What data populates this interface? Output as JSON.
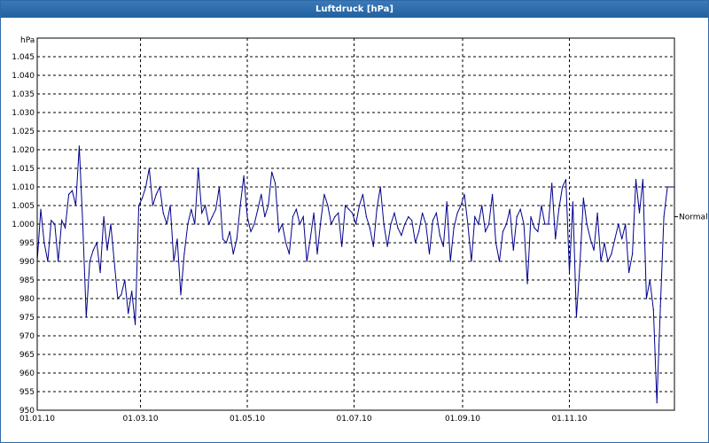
{
  "window": {
    "title": "Luftdruck [hPa]"
  },
  "chart_data": {
    "type": "line",
    "title": "Luftdruck [hPa]",
    "ylabel": "hPa",
    "ylim": [
      950,
      1050
    ],
    "yticks": [
      950,
      955,
      960,
      965,
      970,
      975,
      980,
      985,
      990,
      995,
      1000,
      1005,
      1010,
      1015,
      1020,
      1025,
      1030,
      1035,
      1040,
      1045
    ],
    "ytick_labels": [
      "950",
      "955",
      "960",
      "965",
      "970",
      "975",
      "980",
      "985",
      "990",
      "995",
      "1.000",
      "1.005",
      "1.010",
      "1.015",
      "1.020",
      "1.025",
      "1.030",
      "1.035",
      "1.040",
      "1.045"
    ],
    "xlim": [
      "2010-01-01",
      "2010-12-31"
    ],
    "xticks": [
      "2010-01-01",
      "2010-03-01",
      "2010-05-01",
      "2010-07-01",
      "2010-09-01",
      "2010-11-01"
    ],
    "xtick_labels": [
      "01.01.10",
      "01.03.10",
      "01.05.10",
      "01.07.10",
      "01.09.10",
      "01.11.10"
    ],
    "grid": true,
    "reference_line": {
      "label": "Normal",
      "value": 1002
    },
    "series_color": "#00008b",
    "series": [
      {
        "x": [
          "2010-01-01",
          "2010-01-03",
          "2010-01-05",
          "2010-01-07",
          "2010-01-09",
          "2010-01-11",
          "2010-01-13",
          "2010-01-15",
          "2010-01-17",
          "2010-01-19",
          "2010-01-21",
          "2010-01-23",
          "2010-01-25",
          "2010-01-27",
          "2010-01-29",
          "2010-01-31",
          "2010-02-02",
          "2010-02-04",
          "2010-02-06",
          "2010-02-08",
          "2010-02-10",
          "2010-02-12",
          "2010-02-14",
          "2010-02-16",
          "2010-02-18",
          "2010-02-20",
          "2010-02-22",
          "2010-02-24",
          "2010-02-26",
          "2010-02-28",
          "2010-03-02",
          "2010-03-04",
          "2010-03-06",
          "2010-03-08",
          "2010-03-10",
          "2010-03-12",
          "2010-03-14",
          "2010-03-16",
          "2010-03-18",
          "2010-03-20",
          "2010-03-22",
          "2010-03-24",
          "2010-03-26",
          "2010-03-28",
          "2010-03-30",
          "2010-04-01",
          "2010-04-03",
          "2010-04-05",
          "2010-04-07",
          "2010-04-09",
          "2010-04-11",
          "2010-04-13",
          "2010-04-15",
          "2010-04-17",
          "2010-04-19",
          "2010-04-21",
          "2010-04-23",
          "2010-04-25",
          "2010-04-27",
          "2010-04-29",
          "2010-05-01",
          "2010-05-03",
          "2010-05-05",
          "2010-05-07",
          "2010-05-09",
          "2010-05-11",
          "2010-05-13",
          "2010-05-15",
          "2010-05-17",
          "2010-05-19",
          "2010-05-21",
          "2010-05-23",
          "2010-05-25",
          "2010-05-27",
          "2010-05-29",
          "2010-05-31",
          "2010-06-02",
          "2010-06-04",
          "2010-06-06",
          "2010-06-08",
          "2010-06-10",
          "2010-06-12",
          "2010-06-14",
          "2010-06-16",
          "2010-06-18",
          "2010-06-20",
          "2010-06-22",
          "2010-06-24",
          "2010-06-26",
          "2010-06-28",
          "2010-06-30",
          "2010-07-02",
          "2010-07-04",
          "2010-07-06",
          "2010-07-08",
          "2010-07-10",
          "2010-07-12",
          "2010-07-14",
          "2010-07-16",
          "2010-07-18",
          "2010-07-20",
          "2010-07-22",
          "2010-07-24",
          "2010-07-26",
          "2010-07-28",
          "2010-07-30",
          "2010-08-01",
          "2010-08-03",
          "2010-08-05",
          "2010-08-07",
          "2010-08-09",
          "2010-08-11",
          "2010-08-13",
          "2010-08-15",
          "2010-08-17",
          "2010-08-19",
          "2010-08-21",
          "2010-08-23",
          "2010-08-25",
          "2010-08-27",
          "2010-08-29",
          "2010-08-31",
          "2010-09-02",
          "2010-09-04",
          "2010-09-06",
          "2010-09-08",
          "2010-09-10",
          "2010-09-12",
          "2010-09-14",
          "2010-09-16",
          "2010-09-18",
          "2010-09-20",
          "2010-09-22",
          "2010-09-24",
          "2010-09-26",
          "2010-09-28",
          "2010-09-30",
          "2010-10-02",
          "2010-10-04",
          "2010-10-06",
          "2010-10-08",
          "2010-10-10",
          "2010-10-12",
          "2010-10-14",
          "2010-10-16",
          "2010-10-18",
          "2010-10-20",
          "2010-10-22",
          "2010-10-24",
          "2010-10-26",
          "2010-10-28",
          "2010-10-30",
          "2010-11-01",
          "2010-11-03",
          "2010-11-05",
          "2010-11-07",
          "2010-11-09",
          "2010-11-11",
          "2010-11-13",
          "2010-11-15",
          "2010-11-17",
          "2010-11-19",
          "2010-11-21",
          "2010-11-23",
          "2010-11-25",
          "2010-11-27",
          "2010-11-29",
          "2010-12-01",
          "2010-12-03",
          "2010-12-05",
          "2010-12-07",
          "2010-12-09",
          "2010-12-11",
          "2010-12-13",
          "2010-12-15",
          "2010-12-17",
          "2010-12-19",
          "2010-12-21",
          "2010-12-23",
          "2010-12-25",
          "2010-12-27",
          "2010-12-29",
          "2010-12-31"
        ],
        "values": [
          990,
          1004,
          995,
          990,
          1001,
          1000,
          990,
          1001,
          999,
          1008,
          1009,
          1005,
          1021,
          1000,
          975,
          990,
          993,
          995,
          987,
          1002,
          993,
          1000,
          990,
          980,
          981,
          985,
          976,
          982,
          973,
          1005,
          1007,
          1010,
          1015,
          1005,
          1008,
          1010,
          1003,
          1000,
          1005,
          990,
          996,
          981,
          992,
          1000,
          1004,
          1000,
          1015,
          1003,
          1005,
          1000,
          1002,
          1004,
          1010,
          996,
          995,
          998,
          992,
          996,
          1005,
          1013,
          1002,
          998,
          1000,
          1004,
          1008,
          1002,
          1005,
          1014,
          1011,
          998,
          1000,
          995,
          992,
          1002,
          1004,
          1000,
          1002,
          990,
          996,
          1003,
          992,
          1001,
          1008,
          1005,
          1000,
          1002,
          1003,
          994,
          1005,
          1004,
          1003,
          1000,
          1005,
          1008,
          1002,
          999,
          994,
          1004,
          1010,
          1000,
          994,
          1000,
          1003,
          999,
          997,
          1000,
          1002,
          1001,
          995,
          998,
          1003,
          1000,
          992,
          1001,
          1003,
          997,
          994,
          1006,
          990,
          999,
          1003,
          1005,
          1008,
          1000,
          990,
          1002,
          1000,
          1005,
          998,
          1000,
          1008,
          995,
          990,
          998,
          1000,
          1004,
          993,
          1002,
          1004,
          1000,
          984,
          1002,
          999,
          998,
          1005,
          1000,
          1000,
          1011,
          996,
          1004,
          1010,
          1012,
          987,
          1006,
          975,
          989,
          1007,
          1000,
          996,
          993,
          1003,
          990,
          995,
          990,
          992,
          996,
          1000,
          996,
          1000,
          987,
          992,
          1012,
          1003,
          1012,
          980,
          985,
          977,
          952,
          978,
          1002,
          1010,
          1010,
          1010
        ]
      }
    ]
  }
}
